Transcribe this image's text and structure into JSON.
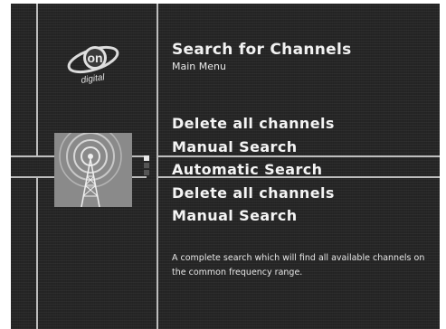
{
  "header": {
    "title": "Search for Channels",
    "subtitle": "Main Menu"
  },
  "logo": {
    "text": "on digital",
    "icon": "ondigital-logo-icon"
  },
  "illustration": {
    "icon": "broadcast-tower-icon"
  },
  "menu": {
    "items": [
      {
        "label": "Delete all channels",
        "selected": false
      },
      {
        "label": "Manual Search",
        "selected": false
      },
      {
        "label": "Automatic Search",
        "selected": true
      },
      {
        "label": "Delete all channels",
        "selected": false
      },
      {
        "label": "Manual Search",
        "selected": false
      }
    ],
    "selected_index": 2
  },
  "description": "A complete search which will find all available channels on the common frequency range.",
  "colors": {
    "background": "#262626",
    "lines": "#bdbdbd",
    "text": "#f4f4f4",
    "illustration_box": "#8a8a8a"
  }
}
